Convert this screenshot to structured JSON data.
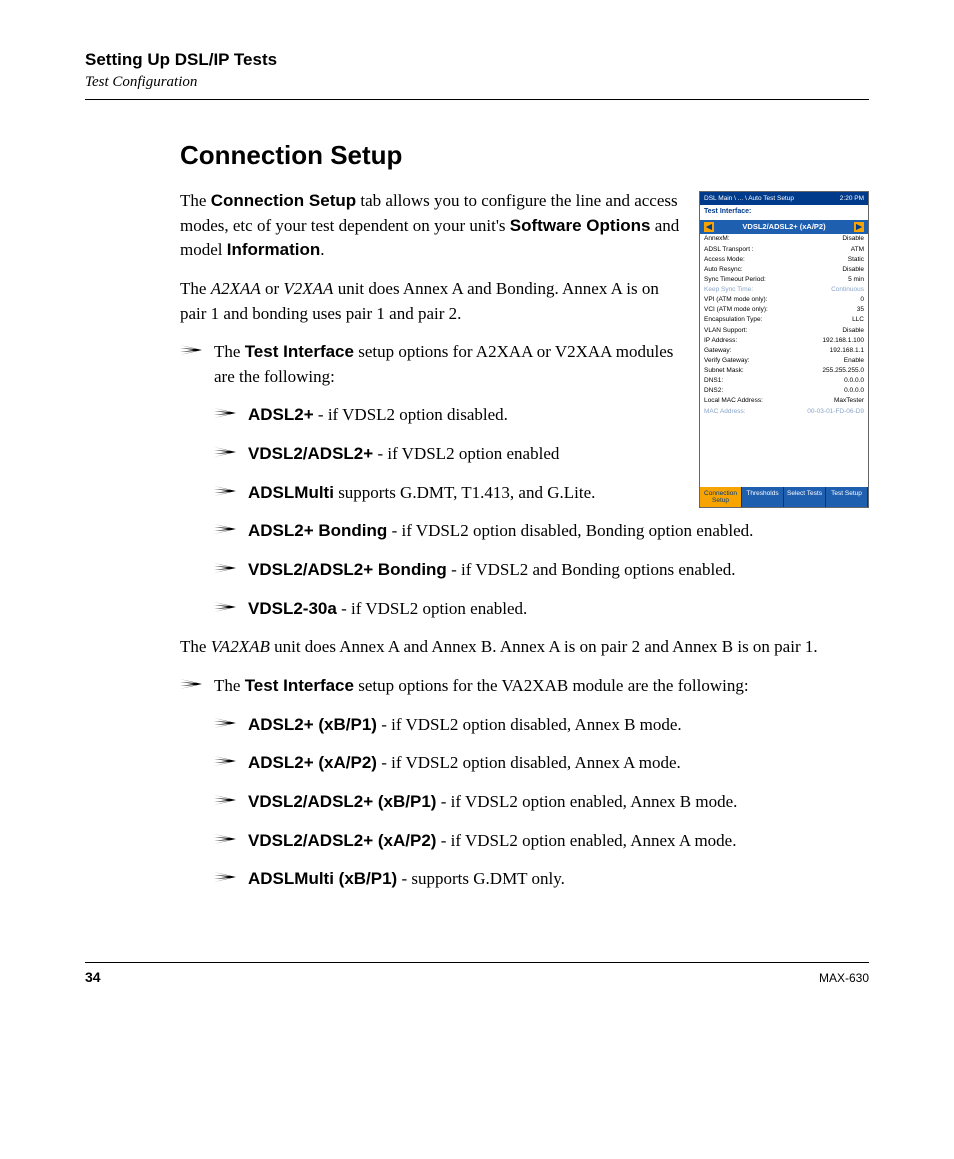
{
  "header": {
    "title": "Setting Up DSL/IP Tests",
    "subtitle": "Test Configuration"
  },
  "section_title": "Connection Setup",
  "intro": {
    "p1_a": "The ",
    "p1_b": "Connection Setup",
    "p1_c": " tab allows you to configure the line and access modes, etc of your test dependent on your unit's ",
    "p1_d": "Software Options",
    "p1_e": " and model ",
    "p1_f": "Information",
    "p1_g": ".",
    "p2_a": "The ",
    "p2_b": "A2XAA",
    "p2_c": " or ",
    "p2_d": "V2XAA",
    "p2_e": " unit does Annex A and Bonding. Annex A is on pair 1 and bonding uses pair 1 and pair 2."
  },
  "list1_intro_a": "The ",
  "list1_intro_b": "Test Interface",
  "list1_intro_c": " setup options for A2XAA or V2XAA modules are the following:",
  "list1": {
    "i1_b": "ADSL2+",
    "i1_t": " - if VDSL2 option disabled.",
    "i2_b": "VDSL2/ADSL2+",
    "i2_t": " - if VDSL2 option enabled",
    "i3_b": "ADSLMulti",
    "i3_t": " supports G.DMT, T1.413, and G.Lite.",
    "i4_b": "ADSL2+ Bonding",
    "i4_t": " - if VDSL2 option disabled, Bonding option enabled.",
    "i5_b": "VDSL2/ADSL2+ Bonding",
    "i5_t": " - if VDSL2 and Bonding options enabled.",
    "i6_b": "VDSL2-30a",
    "i6_t": " - if VDSL2 option enabled."
  },
  "mid_a": "The ",
  "mid_b": "VA2XAB",
  "mid_c": " unit does Annex A and Annex B. Annex A is on pair 2 and Annex B is on pair 1.",
  "list2_intro_a": "The ",
  "list2_intro_b": "Test Interface",
  "list2_intro_c": " setup options for the VA2XAB module are the following:",
  "list2": {
    "i1_b": "ADSL2+ (xB/P1)",
    "i1_t": " - if VDSL2 option disabled, Annex B mode.",
    "i2_b": "ADSL2+ (xA/P2)",
    "i2_t": " - if VDSL2 option disabled, Annex A mode.",
    "i3_b": "VDSL2/ADSL2+ (xB/P1)",
    "i3_t": " - if VDSL2 option enabled, Annex B mode.",
    "i4_b": "VDSL2/ADSL2+ (xA/P2)",
    "i4_t": " - if VDSL2 option enabled, Annex A mode.",
    "i5_b": "ADSLMulti (xB/P1)",
    "i5_t": " - supports G.DMT only."
  },
  "figure": {
    "breadcrumb": "DSL Main \\ ... \\ Auto Test Setup",
    "time": "2:20 PM",
    "label": "Test Interface:",
    "selected": "VDSL2/ADSL2+ (xA/P2)",
    "rows": [
      {
        "k": "AnnexM:",
        "v": "Disable",
        "g": false
      },
      {
        "k": "ADSL Transport :",
        "v": "ATM",
        "g": false
      },
      {
        "k": "Access Mode:",
        "v": "Static",
        "g": false
      },
      {
        "k": "Auto Resync:",
        "v": "Disable",
        "g": false
      },
      {
        "k": "Sync Timeout Period:",
        "v": "5 min",
        "g": false
      },
      {
        "k": "Keep Sync Time:",
        "v": "Continuous",
        "g": true
      },
      {
        "k": "VPI (ATM mode only):",
        "v": "0",
        "g": false
      },
      {
        "k": "VCI (ATM mode only):",
        "v": "35",
        "g": false
      },
      {
        "k": "Encapsulation Type:",
        "v": "LLC",
        "g": false
      },
      {
        "k": "VLAN Support:",
        "v": "Disable",
        "g": false
      },
      {
        "k": "IP Address:",
        "v": "192.168.1.100",
        "g": false
      },
      {
        "k": "Gateway:",
        "v": "192.168.1.1",
        "g": false
      },
      {
        "k": "Verify Gateway:",
        "v": "Enable",
        "g": false
      },
      {
        "k": "Subnet Mask:",
        "v": "255.255.255.0",
        "g": false
      },
      {
        "k": "DNS1:",
        "v": "0.0.0.0",
        "g": false
      },
      {
        "k": "DNS2:",
        "v": "0.0.0.0",
        "g": false
      },
      {
        "k": "Local MAC Address:",
        "v": "MaxTester",
        "g": false
      },
      {
        "k": "MAC Address:",
        "v": "00-03-01-FD-06-D9",
        "g": true
      }
    ],
    "tabs": [
      "Connection Setup",
      "Thresholds",
      "Select Tests",
      "Test Setup"
    ]
  },
  "footer": {
    "page": "34",
    "model": "MAX-630"
  }
}
